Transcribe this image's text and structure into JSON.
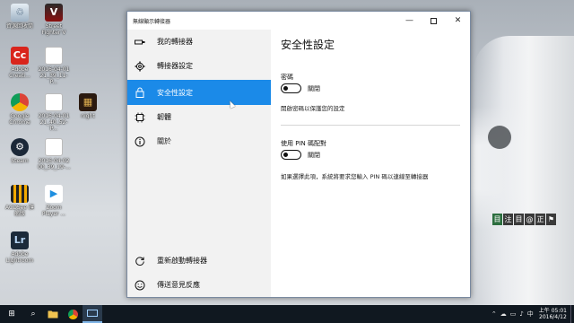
{
  "desktop": {
    "icons": [
      {
        "label": "資源回收筒",
        "icon": "recycle-bin-icon",
        "glyph": "♲"
      },
      {
        "label": "Street Fighter V",
        "icon": "street-fighter-icon",
        "glyph": "V"
      },
      {
        "label": "Adobe Creati...",
        "icon": "adobe-creative-cloud-icon",
        "glyph": "Cc"
      },
      {
        "label": "2016-04-01 21_39_11-P...",
        "icon": "screenshot-file-icon",
        "glyph": ""
      },
      {
        "label": "Google Chrome",
        "icon": "chrome-icon",
        "glyph": ""
      },
      {
        "label": "2016-04-01 21_40_52-P...",
        "icon": "screenshot-file-icon",
        "glyph": ""
      },
      {
        "label": "night",
        "icon": "night-file-icon",
        "glyph": "▦"
      },
      {
        "label": "Steam",
        "icon": "steam-icon",
        "glyph": "⚙"
      },
      {
        "label": "2016-04-02 00_39_19-...",
        "icon": "screenshot-file-icon",
        "glyph": ""
      },
      {
        "label": "ACDSee 旗艦版",
        "icon": "acdsee-icon",
        "glyph": ""
      },
      {
        "label": "Zoom Player ...",
        "icon": "zoom-player-icon",
        "glyph": "▶"
      },
      {
        "label": "Adobe Lightroom",
        "icon": "lightroom-icon",
        "glyph": "Lr"
      }
    ],
    "ime_bar": [
      "目",
      "注",
      "目",
      "@",
      "正",
      "⚑"
    ]
  },
  "window": {
    "title": "無線顯示轉接器",
    "controls": {
      "minimize": "—",
      "maximize": "",
      "close": "✕"
    }
  },
  "sidebar": {
    "items": [
      {
        "label": "我的轉接器",
        "icon": "adapter-icon"
      },
      {
        "label": "轉接器設定",
        "icon": "gear-icon"
      },
      {
        "label": "安全性設定",
        "icon": "lock-icon",
        "active": true
      },
      {
        "label": "韌體",
        "icon": "chip-icon"
      },
      {
        "label": "關於",
        "icon": "info-icon"
      }
    ],
    "bottom_items": [
      {
        "label": "重新啟動轉接器",
        "icon": "restart-icon"
      },
      {
        "label": "傳送意見反應",
        "icon": "feedback-icon"
      }
    ]
  },
  "main": {
    "title": "安全性設定",
    "password": {
      "label": "密碼",
      "toggle_state": "關閉",
      "description": "開啟密碼以保護您的設定"
    },
    "pin": {
      "label": "使用 PIN 碼配對",
      "toggle_state": "關閉",
      "description": "如果選擇此項，系統將要求您輸入 PIN 碼以連線至轉接器"
    }
  },
  "taskbar": {
    "buttons": [
      {
        "name": "start-button",
        "glyph": "⊞"
      },
      {
        "name": "search-button",
        "glyph": "⌕"
      },
      {
        "name": "file-explorer-button",
        "glyph": "▬"
      },
      {
        "name": "chrome-button",
        "glyph": "●"
      },
      {
        "name": "wireless-display-button",
        "glyph": "▭",
        "active": true
      }
    ],
    "tray": [
      "⌃",
      "☁",
      "▭",
      "♪",
      "中"
    ],
    "clock": {
      "time": "上午 05:01",
      "date": "2016/4/12"
    },
    "colors": {
      "accent": "#1b8ae8",
      "taskbar": "#101820"
    }
  }
}
